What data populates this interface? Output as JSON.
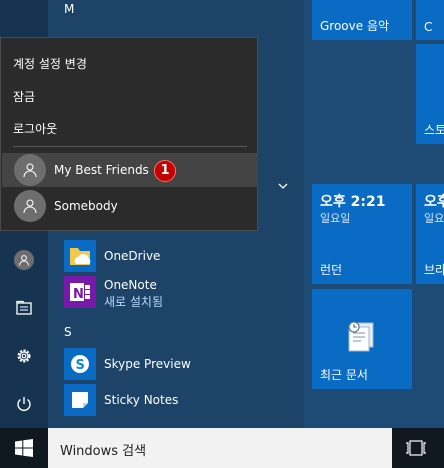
{
  "account_menu": {
    "items": [
      {
        "label": "계정 설정 변경"
      },
      {
        "label": "잠금"
      },
      {
        "label": "로그아웃"
      }
    ],
    "accounts": [
      {
        "name": "My Best Friends",
        "badge": "1"
      },
      {
        "name": "Somebody"
      }
    ]
  },
  "app_list": {
    "letter_m": "M",
    "letter_s": "S",
    "apps": [
      {
        "name": "OneDrive"
      },
      {
        "name": "OneNote",
        "subtitle": "새로 설치됨"
      },
      {
        "name": "Skype Preview"
      },
      {
        "name": "Sticky Notes"
      }
    ]
  },
  "tiles": {
    "groove": "Groove 음악",
    "clock_time": "오후 2:21",
    "clock_day": "일요일",
    "clock_label": "런던",
    "clock2_time": "오후",
    "clock2_day": "일요",
    "clock2_label": "브라",
    "recent_docs": "최근 문서",
    "partial_tile_1": "C",
    "partial_tile_2": "스토"
  },
  "taskbar": {
    "search_placeholder": "Windows 검색"
  },
  "colors": {
    "tile_blue": "#0a6bc4",
    "badge_red": "#c40000"
  }
}
